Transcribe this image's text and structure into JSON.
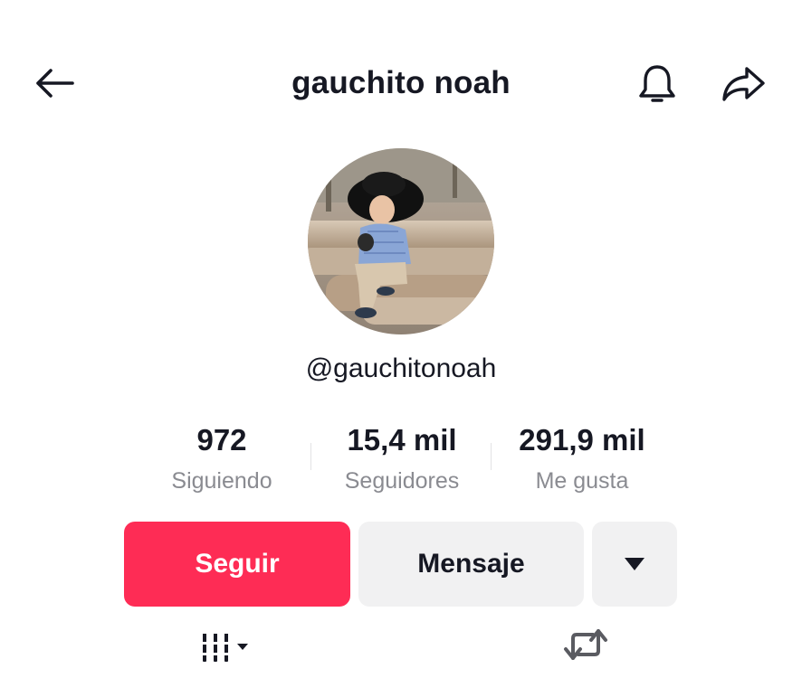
{
  "header": {
    "title": "gauchito noah",
    "back_icon": "arrow-left-icon",
    "bell_icon": "bell-icon",
    "share_icon": "share-arrow-icon"
  },
  "profile": {
    "avatar": "profile-photo",
    "username": "@gauchitonoah"
  },
  "stats": [
    {
      "value": "972",
      "label": "Siguiendo"
    },
    {
      "value": "15,4 mil",
      "label": "Seguidores"
    },
    {
      "value": "291,9 mil",
      "label": "Me gusta"
    }
  ],
  "actions": {
    "follow_label": "Seguir",
    "message_label": "Mensaje",
    "more_icon": "caret-down-icon"
  },
  "tabs": {
    "videos_icon": "grid-columns-icon",
    "reposts_icon": "repost-icon"
  },
  "colors": {
    "accent": "#fe2c55",
    "secondary_button": "#f1f1f2",
    "text": "#161823",
    "muted": "#8a8b91"
  }
}
